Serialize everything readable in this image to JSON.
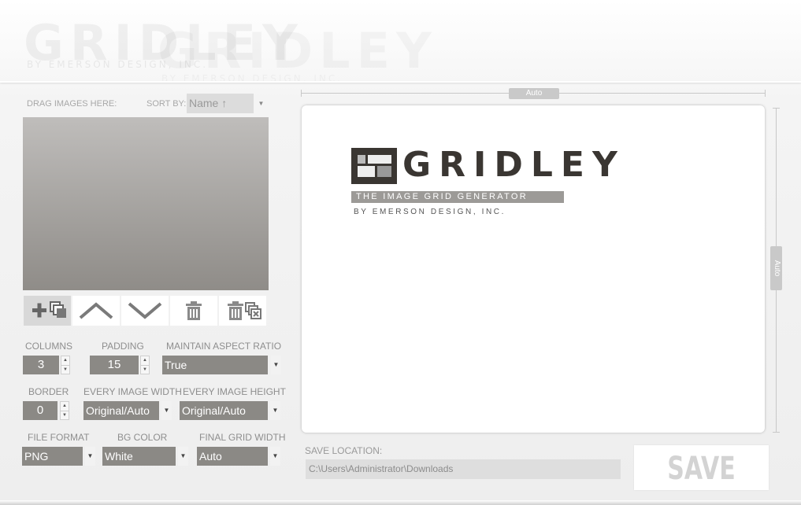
{
  "header": {
    "watermark_title": "GRIDLEY",
    "watermark_sub": "BY EMERSON DESIGN, INC."
  },
  "left": {
    "drag_label": "DRAG IMAGES HERE:",
    "sort_label": "SORT BY:",
    "sort_value": "Name ↑"
  },
  "toolbar": {
    "add": "add-images",
    "up": "move-up",
    "down": "move-down",
    "delete": "delete",
    "delete_all": "delete-all"
  },
  "settings": {
    "columns_label": "COLUMNS",
    "columns_value": "3",
    "padding_label": "PADDING",
    "padding_value": "15",
    "aspect_label": "MAINTAIN ASPECT RATIO",
    "aspect_value": "True",
    "border_label": "BORDER",
    "border_value": "0",
    "img_width_label": "EVERY IMAGE WIDTH",
    "img_width_value": "Original/Auto",
    "img_height_label": "EVERY IMAGE HEIGHT",
    "img_height_value": "Original/Auto",
    "format_label": "FILE FORMAT",
    "format_value": "PNG",
    "bg_label": "BG COLOR",
    "bg_value": "White",
    "grid_width_label": "FINAL GRID WIDTH",
    "grid_width_value": "Auto"
  },
  "preview": {
    "width_ruler": "Auto",
    "height_ruler": "Auto",
    "logo_title": "GRIDLEY",
    "logo_tagline": "THE IMAGE GRID GENERATOR",
    "logo_byline": "BY EMERSON DESIGN, INC."
  },
  "save": {
    "location_label": "SAVE LOCATION:",
    "location_value": "C:\\Users\\Administrator\\Downloads",
    "button_label": "SAVE"
  }
}
